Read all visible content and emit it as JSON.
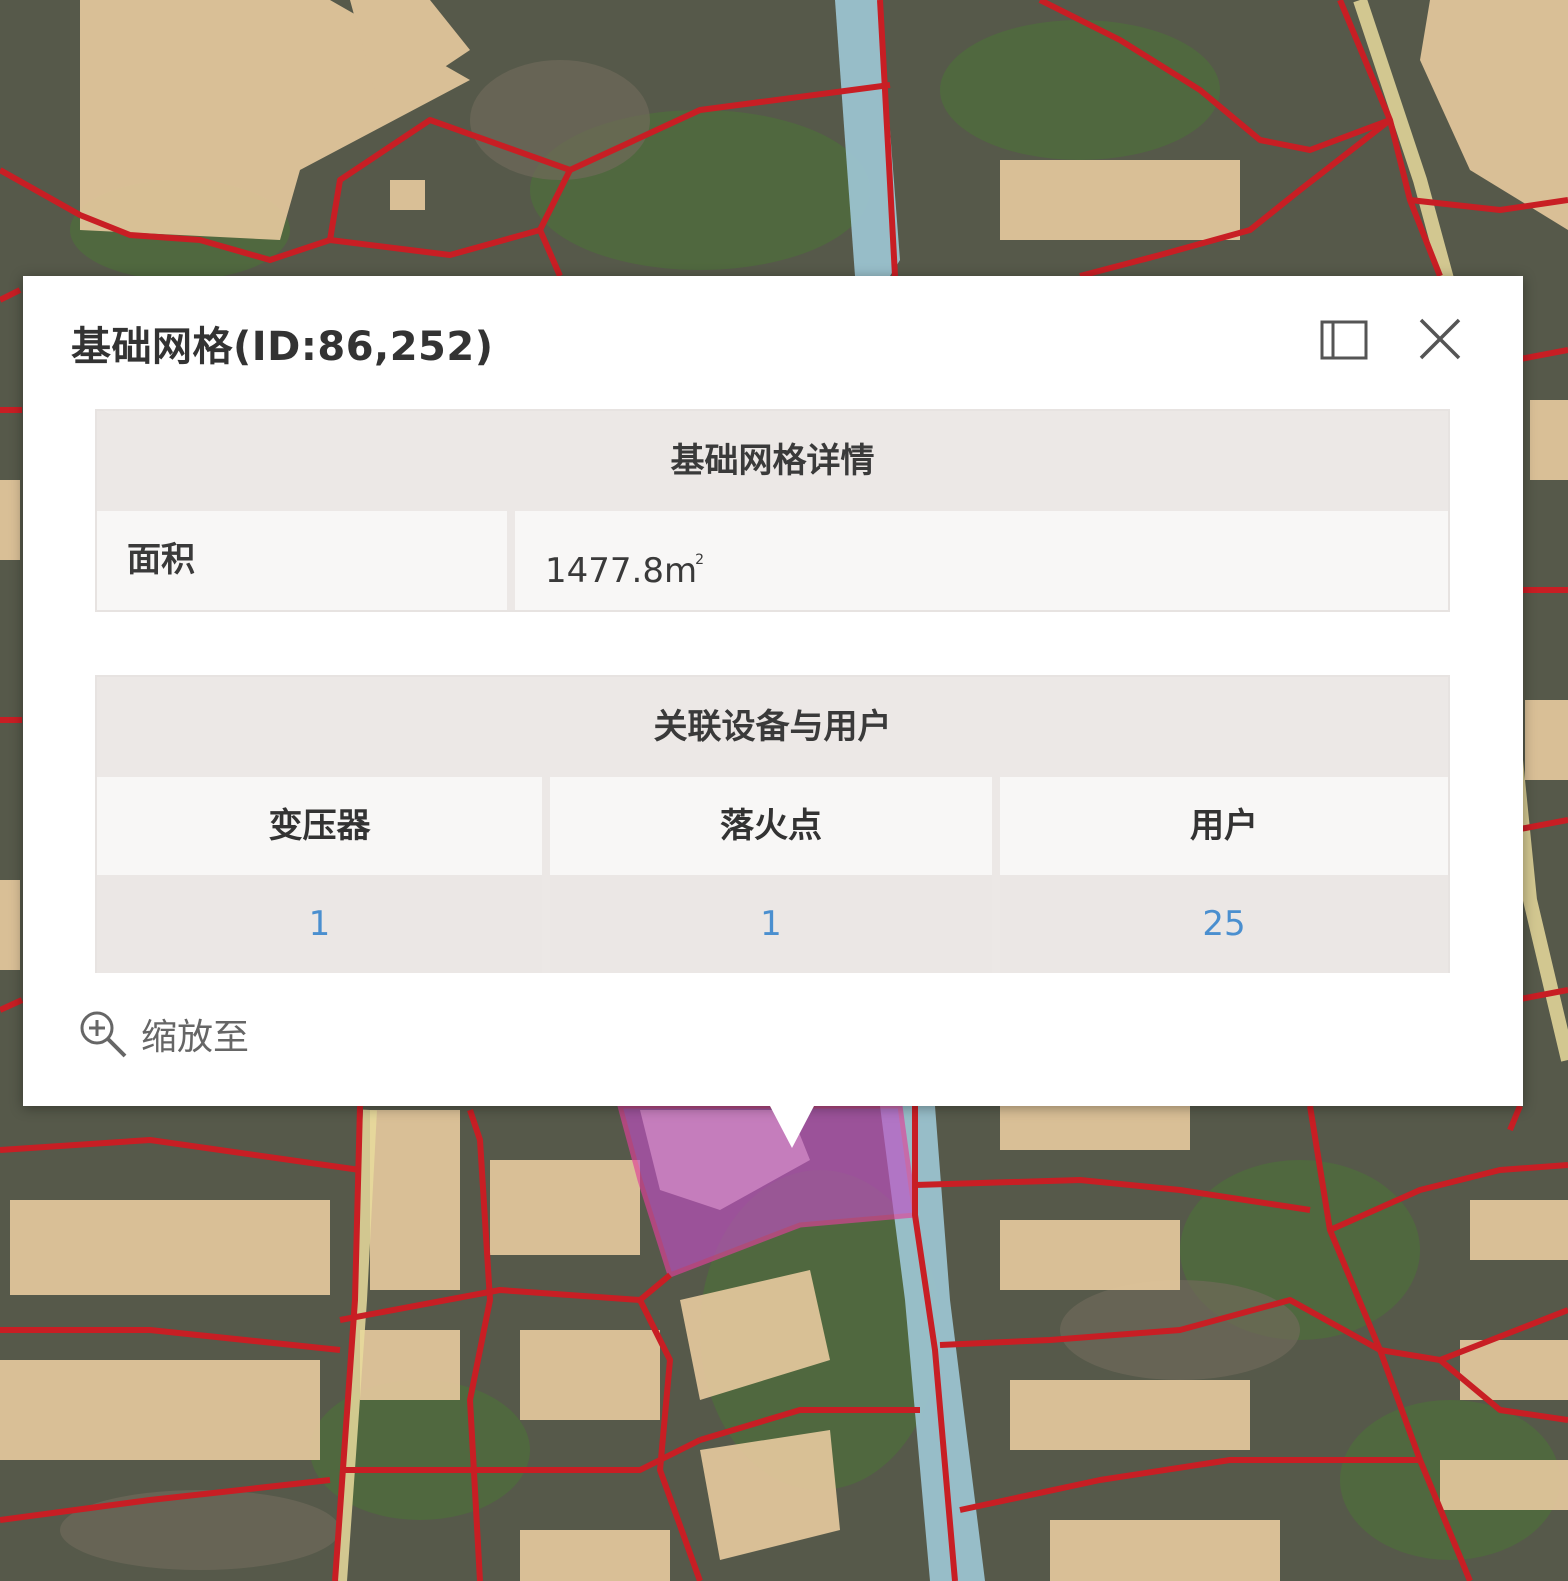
{
  "map": {
    "palette": {
      "imagery": "#56594a",
      "green": "#4f6b3d",
      "building": "#e3c79c",
      "grid_line": "#c81e24",
      "road": "#e8db9c",
      "waterway": "#9ec8d6",
      "selected": "#c04fc4"
    }
  },
  "popup": {
    "title": "基础网格(ID:86,252)",
    "dock_icon": "dock-panel-icon",
    "close_icon": "close-icon",
    "details": {
      "header": "基础网格详情",
      "area_label": "面积",
      "area_value": "1477.8m",
      "area_unit_sup": "2"
    },
    "related": {
      "header": "关联设备与用户",
      "columns": [
        "变压器",
        "落火点",
        "用户"
      ],
      "values": [
        "1",
        "1",
        "25"
      ],
      "value_color": "#4a8fcf"
    },
    "zoom": {
      "icon": "zoom-in-icon",
      "label": "缩放至"
    }
  }
}
